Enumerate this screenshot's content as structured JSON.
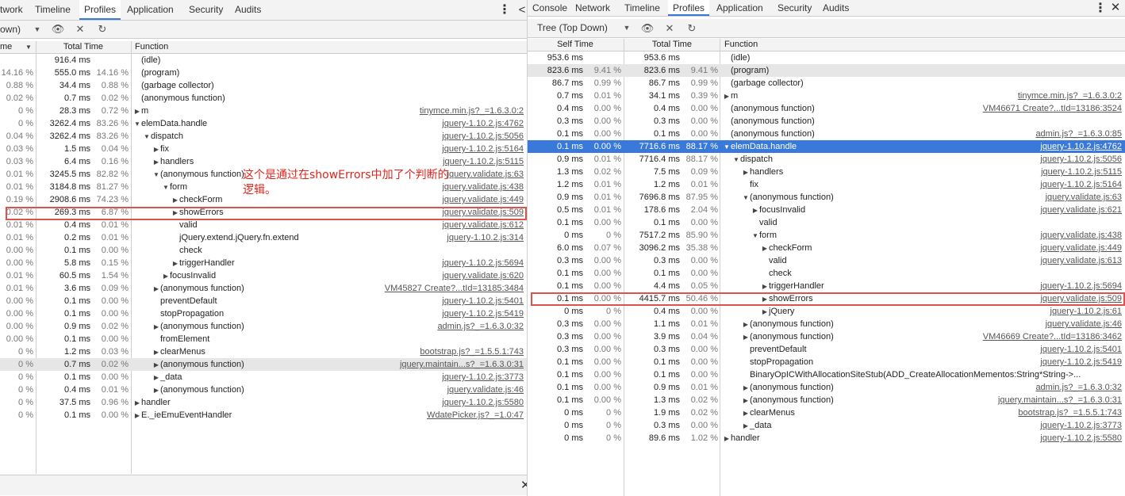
{
  "left": {
    "tabs": [
      "twork",
      "Timeline",
      "Profiles",
      "Application",
      "Security",
      "Audits"
    ],
    "active_tab": 2,
    "view_select": "own)",
    "col_self": "me",
    "col_total": "Total Time",
    "col_function": "Function",
    "rows": [
      {
        "sp": "",
        "tt": "916.4 ms",
        "tp": "",
        "d": 0,
        "e": "",
        "f": "(idle)",
        "l": ""
      },
      {
        "sp": "14.16 %",
        "tt": "555.0 ms",
        "tp": "14.16 %",
        "d": 0,
        "e": "",
        "f": "(program)",
        "l": ""
      },
      {
        "sp": "0.88 %",
        "tt": "34.4 ms",
        "tp": "0.88 %",
        "d": 0,
        "e": "",
        "f": "(garbage collector)",
        "l": ""
      },
      {
        "sp": "0.02 %",
        "tt": "0.7 ms",
        "tp": "0.02 %",
        "d": 0,
        "e": "",
        "f": "(anonymous function)",
        "l": ""
      },
      {
        "sp": "0 %",
        "tt": "28.3 ms",
        "tp": "0.72 %",
        "d": 0,
        "e": "c",
        "f": "m",
        "l": "tinymce.min.js?_=1.6.3.0:2"
      },
      {
        "sp": "0 %",
        "tt": "3262.4 ms",
        "tp": "83.26 %",
        "d": 0,
        "e": "o",
        "f": "elemData.handle",
        "l": "jquery-1.10.2.js:4762"
      },
      {
        "sp": "0.04 %",
        "tt": "3262.4 ms",
        "tp": "83.26 %",
        "d": 1,
        "e": "o",
        "f": "dispatch",
        "l": "jquery-1.10.2.js:5056"
      },
      {
        "sp": "0.03 %",
        "tt": "1.5 ms",
        "tp": "0.04 %",
        "d": 2,
        "e": "c",
        "f": "fix",
        "l": "jquery-1.10.2.js:5164"
      },
      {
        "sp": "0.03 %",
        "tt": "6.4 ms",
        "tp": "0.16 %",
        "d": 2,
        "e": "c",
        "f": "handlers",
        "l": "jquery-1.10.2.js:5115"
      },
      {
        "sp": "0.01 %",
        "tt": "3245.5 ms",
        "tp": "82.82 %",
        "d": 2,
        "e": "o",
        "f": "(anonymous function)",
        "l": "jquery.validate.js:63"
      },
      {
        "sp": "0.01 %",
        "tt": "3184.8 ms",
        "tp": "81.27 %",
        "d": 3,
        "e": "o",
        "f": "form",
        "l": "jquery.validate.js:438"
      },
      {
        "sp": "0.19 %",
        "tt": "2908.6 ms",
        "tp": "74.23 %",
        "d": 4,
        "e": "c",
        "f": "checkForm",
        "l": "jquery.validate.js:449"
      },
      {
        "sp": "0.02 %",
        "tt": "269.3 ms",
        "tp": "6.87 %",
        "d": 4,
        "e": "c",
        "f": "showErrors",
        "l": "jquery.validate.js:509"
      },
      {
        "sp": "0.01 %",
        "tt": "0.4 ms",
        "tp": "0.01 %",
        "d": 4,
        "e": "",
        "f": "valid",
        "l": "jquery.validate.js:612"
      },
      {
        "sp": "0.01 %",
        "tt": "0.2 ms",
        "tp": "0.01 %",
        "d": 4,
        "e": "",
        "f": "jQuery.extend.jQuery.fn.extend",
        "l": "jquery-1.10.2.js:314"
      },
      {
        "sp": "0.00 %",
        "tt": "0.1 ms",
        "tp": "0.00 %",
        "d": 4,
        "e": "",
        "f": "check",
        "l": ""
      },
      {
        "sp": "0.00 %",
        "tt": "5.8 ms",
        "tp": "0.15 %",
        "d": 4,
        "e": "c",
        "f": "triggerHandler",
        "l": "jquery-1.10.2.js:5694"
      },
      {
        "sp": "0.01 %",
        "tt": "60.5 ms",
        "tp": "1.54 %",
        "d": 3,
        "e": "c",
        "f": "focusInvalid",
        "l": "jquery.validate.js:620"
      },
      {
        "sp": "0.01 %",
        "tt": "3.6 ms",
        "tp": "0.09 %",
        "d": 2,
        "e": "c",
        "f": "(anonymous function)",
        "l": "VM45827 Create?...tId=13185:3484"
      },
      {
        "sp": "0.00 %",
        "tt": "0.1 ms",
        "tp": "0.00 %",
        "d": 2,
        "e": "",
        "f": "preventDefault",
        "l": "jquery-1.10.2.js:5401"
      },
      {
        "sp": "0.00 %",
        "tt": "0.1 ms",
        "tp": "0.00 %",
        "d": 2,
        "e": "",
        "f": "stopPropagation",
        "l": "jquery-1.10.2.js:5419"
      },
      {
        "sp": "0.00 %",
        "tt": "0.9 ms",
        "tp": "0.02 %",
        "d": 2,
        "e": "c",
        "f": "(anonymous function)",
        "l": "admin.js?_=1.6.3.0:32"
      },
      {
        "sp": "0.00 %",
        "tt": "0.1 ms",
        "tp": "0.00 %",
        "d": 2,
        "e": "",
        "f": "fromElement",
        "l": ""
      },
      {
        "sp": "0 %",
        "tt": "1.2 ms",
        "tp": "0.03 %",
        "d": 2,
        "e": "c",
        "f": "clearMenus",
        "l": "bootstrap.js?_=1.5.5.1:743"
      },
      {
        "sp": "0 %",
        "tt": "0.7 ms",
        "tp": "0.02 %",
        "d": 2,
        "e": "c",
        "f": "(anonymous function)",
        "l": "jquery.maintain...s?_=1.6.3.0:31"
      },
      {
        "sp": "0 %",
        "tt": "0.1 ms",
        "tp": "0.00 %",
        "d": 2,
        "e": "c",
        "f": "_data",
        "l": "jquery-1.10.2.js:3773"
      },
      {
        "sp": "0 %",
        "tt": "0.4 ms",
        "tp": "0.01 %",
        "d": 2,
        "e": "c",
        "f": "(anonymous function)",
        "l": "jquery.validate.js:46"
      },
      {
        "sp": "0 %",
        "tt": "37.5 ms",
        "tp": "0.96 %",
        "d": 0,
        "e": "c",
        "f": "handler",
        "l": "jquery-1.10.2.js:5580"
      },
      {
        "sp": "0 %",
        "tt": "0.1 ms",
        "tp": "0.00 %",
        "d": 0,
        "e": "c",
        "f": "E._ieEmuEventHandler",
        "l": "WdatePicker.js?_=1.0:47"
      }
    ],
    "annotation_line1": "这个是通过在showErrors中加了个判断的",
    "annotation_line2": "逻辑。"
  },
  "right": {
    "tabs": [
      "Console",
      "Network",
      "Timeline",
      "Profiles",
      "Application",
      "Security",
      "Audits"
    ],
    "active_tab": 3,
    "view_select": "Tree (Top Down)",
    "col_self": "Self Time",
    "col_total": "Total Time",
    "col_function": "Function",
    "rows": [
      {
        "st": "953.6 ms",
        "sp": "",
        "tt": "953.6 ms",
        "tp": "",
        "d": 0,
        "e": "",
        "f": "(idle)",
        "l": ""
      },
      {
        "st": "823.6 ms",
        "sp": "9.41 %",
        "tt": "823.6 ms",
        "tp": "9.41 %",
        "d": 0,
        "e": "",
        "f": "(program)",
        "l": ""
      },
      {
        "st": "86.7 ms",
        "sp": "0.99 %",
        "tt": "86.7 ms",
        "tp": "0.99 %",
        "d": 0,
        "e": "",
        "f": "(garbage collector)",
        "l": ""
      },
      {
        "st": "0.7 ms",
        "sp": "0.01 %",
        "tt": "34.1 ms",
        "tp": "0.39 %",
        "d": 0,
        "e": "c",
        "f": "m",
        "l": "tinymce.min.js?_=1.6.3.0:2"
      },
      {
        "st": "0.4 ms",
        "sp": "0.00 %",
        "tt": "0.4 ms",
        "tp": "0.00 %",
        "d": 0,
        "e": "",
        "f": "(anonymous function)",
        "l": "VM46671 Create?...tId=13186:3524"
      },
      {
        "st": "0.3 ms",
        "sp": "0.00 %",
        "tt": "0.3 ms",
        "tp": "0.00 %",
        "d": 0,
        "e": "",
        "f": "(anonymous function)",
        "l": ""
      },
      {
        "st": "0.1 ms",
        "sp": "0.00 %",
        "tt": "0.1 ms",
        "tp": "0.00 %",
        "d": 0,
        "e": "",
        "f": "(anonymous function)",
        "l": "admin.js?_=1.6.3.0:85"
      },
      {
        "st": "0.1 ms",
        "sp": "0.00 %",
        "tt": "7716.6 ms",
        "tp": "88.17 %",
        "d": 0,
        "e": "o",
        "f": "elemData.handle",
        "l": "jquery-1.10.2.js:4762"
      },
      {
        "st": "0.9 ms",
        "sp": "0.01 %",
        "tt": "7716.4 ms",
        "tp": "88.17 %",
        "d": 1,
        "e": "o",
        "f": "dispatch",
        "l": "jquery-1.10.2.js:5056"
      },
      {
        "st": "1.3 ms",
        "sp": "0.02 %",
        "tt": "7.5 ms",
        "tp": "0.09 %",
        "d": 2,
        "e": "c",
        "f": "handlers",
        "l": "jquery-1.10.2.js:5115"
      },
      {
        "st": "1.2 ms",
        "sp": "0.01 %",
        "tt": "1.2 ms",
        "tp": "0.01 %",
        "d": 2,
        "e": "",
        "f": "fix",
        "l": "jquery-1.10.2.js:5164"
      },
      {
        "st": "0.9 ms",
        "sp": "0.01 %",
        "tt": "7696.8 ms",
        "tp": "87.95 %",
        "d": 2,
        "e": "o",
        "f": "(anonymous function)",
        "l": "jquery.validate.js:63"
      },
      {
        "st": "0.5 ms",
        "sp": "0.01 %",
        "tt": "178.6 ms",
        "tp": "2.04 %",
        "d": 3,
        "e": "c",
        "f": "focusInvalid",
        "l": "jquery.validate.js:621"
      },
      {
        "st": "0.1 ms",
        "sp": "0.00 %",
        "tt": "0.1 ms",
        "tp": "0.00 %",
        "d": 3,
        "e": "",
        "f": "valid",
        "l": ""
      },
      {
        "st": "0 ms",
        "sp": "0 %",
        "tt": "7517.2 ms",
        "tp": "85.90 %",
        "d": 3,
        "e": "o",
        "f": "form",
        "l": "jquery.validate.js:438"
      },
      {
        "st": "6.0 ms",
        "sp": "0.07 %",
        "tt": "3096.2 ms",
        "tp": "35.38 %",
        "d": 4,
        "e": "c",
        "f": "checkForm",
        "l": "jquery.validate.js:449"
      },
      {
        "st": "0.3 ms",
        "sp": "0.00 %",
        "tt": "0.3 ms",
        "tp": "0.00 %",
        "d": 4,
        "e": "",
        "f": "valid",
        "l": "jquery.validate.js:613"
      },
      {
        "st": "0.1 ms",
        "sp": "0.00 %",
        "tt": "0.1 ms",
        "tp": "0.00 %",
        "d": 4,
        "e": "",
        "f": "check",
        "l": ""
      },
      {
        "st": "0.1 ms",
        "sp": "0.00 %",
        "tt": "4.4 ms",
        "tp": "0.05 %",
        "d": 4,
        "e": "c",
        "f": "triggerHandler",
        "l": "jquery-1.10.2.js:5694"
      },
      {
        "st": "0.1 ms",
        "sp": "0.00 %",
        "tt": "4415.7 ms",
        "tp": "50.46 %",
        "d": 4,
        "e": "c",
        "f": "showErrors",
        "l": "jquery.validate.js:509"
      },
      {
        "st": "0 ms",
        "sp": "0 %",
        "tt": "0.4 ms",
        "tp": "0.00 %",
        "d": 4,
        "e": "c",
        "f": "jQuery",
        "l": "jquery-1.10.2.js:61"
      },
      {
        "st": "0.3 ms",
        "sp": "0.00 %",
        "tt": "1.1 ms",
        "tp": "0.01 %",
        "d": 2,
        "e": "c",
        "f": "(anonymous function)",
        "l": "jquery.validate.js:46"
      },
      {
        "st": "0.3 ms",
        "sp": "0.00 %",
        "tt": "3.9 ms",
        "tp": "0.04 %",
        "d": 2,
        "e": "c",
        "f": "(anonymous function)",
        "l": "VM46669 Create?...tId=13186:3462"
      },
      {
        "st": "0.3 ms",
        "sp": "0.00 %",
        "tt": "0.3 ms",
        "tp": "0.00 %",
        "d": 2,
        "e": "",
        "f": "preventDefault",
        "l": "jquery-1.10.2.js:5401"
      },
      {
        "st": "0.1 ms",
        "sp": "0.00 %",
        "tt": "0.1 ms",
        "tp": "0.00 %",
        "d": 2,
        "e": "",
        "f": "stopPropagation",
        "l": "jquery-1.10.2.js:5419"
      },
      {
        "st": "0.1 ms",
        "sp": "0.00 %",
        "tt": "0.1 ms",
        "tp": "0.00 %",
        "d": 2,
        "e": "",
        "f": "BinaryOpICWithAllocationSiteStub(ADD_CreateAllocationMementos:String*String->...",
        "l": ""
      },
      {
        "st": "0.1 ms",
        "sp": "0.00 %",
        "tt": "0.9 ms",
        "tp": "0.01 %",
        "d": 2,
        "e": "c",
        "f": "(anonymous function)",
        "l": "admin.js?_=1.6.3.0:32"
      },
      {
        "st": "0.1 ms",
        "sp": "0.00 %",
        "tt": "1.3 ms",
        "tp": "0.02 %",
        "d": 2,
        "e": "c",
        "f": "(anonymous function)",
        "l": "jquery.maintain...s?_=1.6.3.0:31"
      },
      {
        "st": "0 ms",
        "sp": "0 %",
        "tt": "1.9 ms",
        "tp": "0.02 %",
        "d": 2,
        "e": "c",
        "f": "clearMenus",
        "l": "bootstrap.js?_=1.5.5.1:743"
      },
      {
        "st": "0 ms",
        "sp": "0 %",
        "tt": "0.3 ms",
        "tp": "0.00 %",
        "d": 2,
        "e": "c",
        "f": "_data",
        "l": "jquery-1.10.2.js:3773"
      },
      {
        "st": "0 ms",
        "sp": "0 %",
        "tt": "89.6 ms",
        "tp": "1.02 %",
        "d": 0,
        "e": "c",
        "f": "handler",
        "l": "jquery-1.10.2.js:5580"
      }
    ]
  },
  "icons": {
    "kebab": "⋮",
    "close": "✕",
    "eye": "👁",
    "clear": "✕",
    "reload": "↻",
    "dropdown": "▼",
    "expanded": "▼",
    "collapsed": "▶",
    "back": "<",
    "bottom_close": "✕"
  },
  "colors": {
    "selection": "#3879d9",
    "highlight_box": "#d9534f",
    "annotation": "#e0241b"
  }
}
